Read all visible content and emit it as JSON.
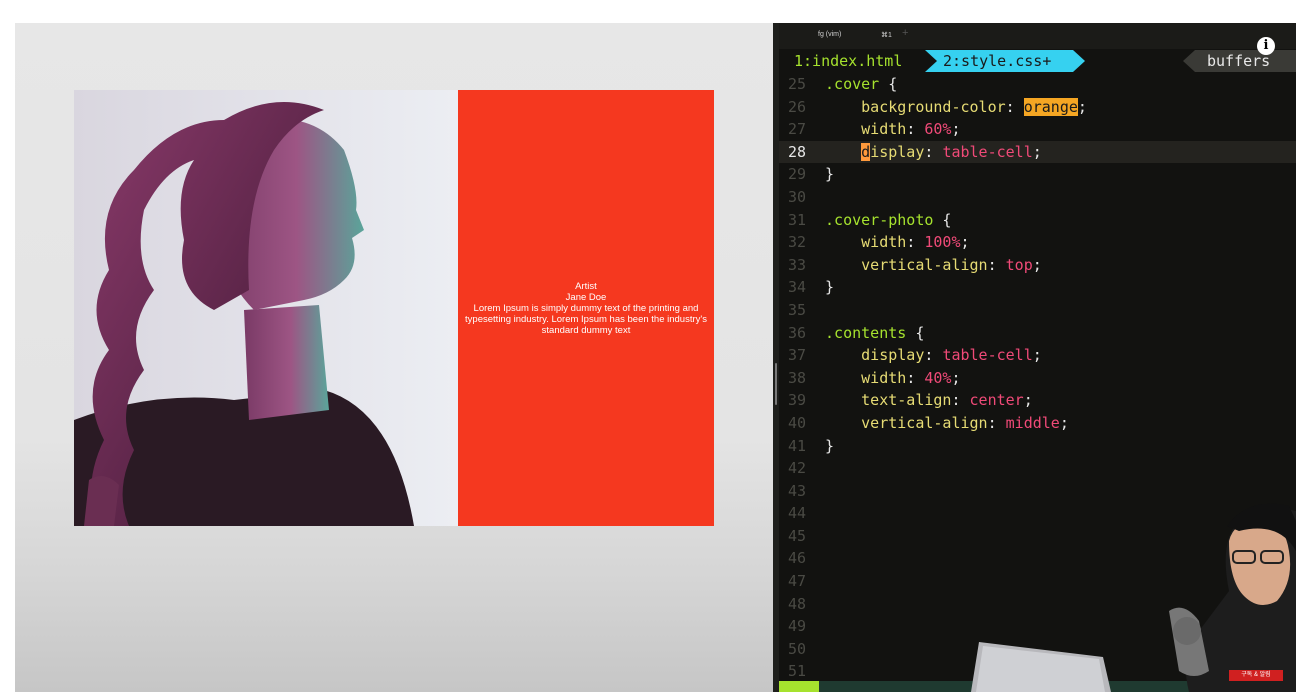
{
  "preview": {
    "contents_lines": [
      "Artist",
      "Jane Doe",
      "Lorem Ipsum is simply dummy text of the printing and typesetting industry. Lorem Ipsum has been the industry's standard dummy text"
    ]
  },
  "terminal": {
    "title": "fg (vim)",
    "shortcut": "⌘1",
    "new_tab": "+",
    "info": "i"
  },
  "vim": {
    "tabs": {
      "tab1": "1:index.html",
      "tab2": "2:style.css+",
      "right": "buffers"
    },
    "lines": [
      {
        "n": "25",
        "t": ".cover {"
      },
      {
        "n": "26",
        "t": "    background-color: orange;"
      },
      {
        "n": "27",
        "t": "    width: 60%;"
      },
      {
        "n": "28",
        "t": "    display: table-cell;"
      },
      {
        "n": "29",
        "t": "}"
      },
      {
        "n": "30",
        "t": ""
      },
      {
        "n": "31",
        "t": ".cover-photo {"
      },
      {
        "n": "32",
        "t": "    width: 100%;"
      },
      {
        "n": "33",
        "t": "    vertical-align: top;"
      },
      {
        "n": "34",
        "t": "}"
      },
      {
        "n": "35",
        "t": ""
      },
      {
        "n": "36",
        "t": ".contents {"
      },
      {
        "n": "37",
        "t": "    display: table-cell;"
      },
      {
        "n": "38",
        "t": "    width: 40%;"
      },
      {
        "n": "39",
        "t": "    text-align: center;"
      },
      {
        "n": "40",
        "t": "    vertical-align: middle;"
      },
      {
        "n": "41",
        "t": "}"
      },
      {
        "n": "42",
        "t": ""
      },
      {
        "n": "43",
        "t": ""
      },
      {
        "n": "44",
        "t": ""
      },
      {
        "n": "45",
        "t": ""
      },
      {
        "n": "46",
        "t": ""
      },
      {
        "n": "47",
        "t": ""
      },
      {
        "n": "48",
        "t": ""
      },
      {
        "n": "49",
        "t": ""
      },
      {
        "n": "50",
        "t": ""
      },
      {
        "n": "51",
        "t": ""
      }
    ],
    "current_line": "28"
  },
  "overlay": {
    "badge": "구독 & 알림"
  },
  "colors": {
    "contents_bg": "#f5381f",
    "tab_active": "#36d1f0",
    "selector": "#a6e22e",
    "property": "#e6db74",
    "value": "#f04a78",
    "search_highlight": "#f5a623"
  }
}
